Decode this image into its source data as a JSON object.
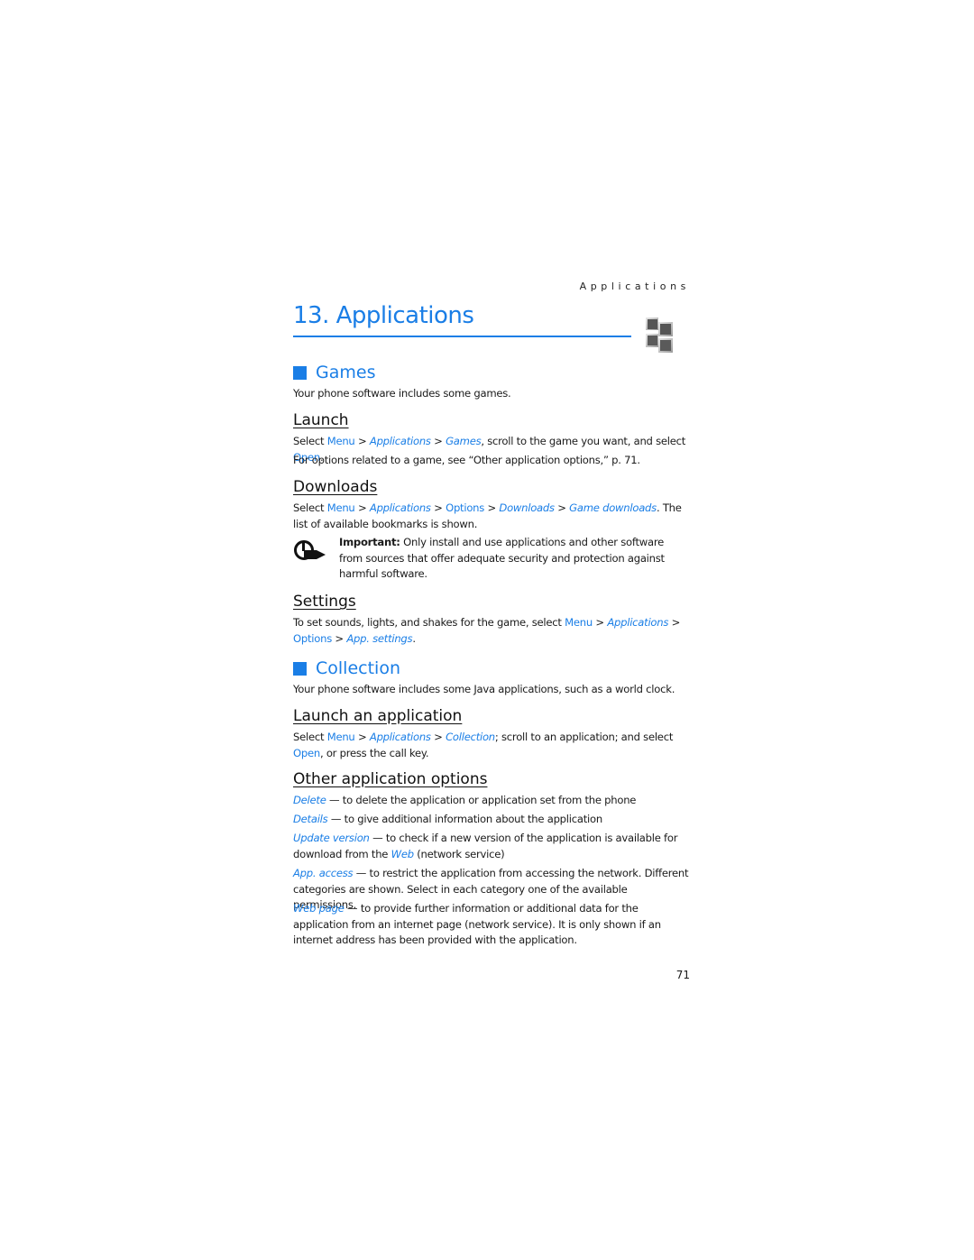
{
  "running_head": "Applications",
  "chapter": {
    "title": "13. Applications",
    "icon": "applications-cubes-icon"
  },
  "games": {
    "heading": "Games",
    "intro": "Your phone software includes some games.",
    "launch": {
      "heading": "Launch",
      "line1": {
        "pre": "Select ",
        "menu": "Menu",
        "sep1": " > ",
        "applications": "Applications",
        "sep2": " > ",
        "games": "Games",
        "mid": ", scroll to the game you want, and select ",
        "open": "Open",
        "post": "."
      },
      "line2": "For options related to a game, see “Other application options,” p. 71."
    },
    "downloads": {
      "heading": "Downloads",
      "line": {
        "pre": "Select ",
        "menu": "Menu",
        "sep1": " > ",
        "applications": "Applications",
        "sep2": " > ",
        "options": "Options",
        "sep3": " > ",
        "downloads": "Downloads",
        "sep4": " > ",
        "game_downloads": "Game downloads",
        "post": ". The list of available bookmarks is shown."
      },
      "note": {
        "label": "Important:",
        "text": " Only install and use applications and other software from sources that offer adequate security and protection against harmful software."
      }
    },
    "settings": {
      "heading": "Settings",
      "line": {
        "pre": "To set sounds, lights, and shakes for the game, select ",
        "menu": "Menu",
        "sep1": " > ",
        "applications": "Applications",
        "sep2": " > ",
        "options": "Options",
        "sep3": " > ",
        "app_settings": "App. settings",
        "post": "."
      }
    }
  },
  "collection": {
    "heading": "Collection",
    "intro": "Your phone software includes some Java applications, such as a world clock.",
    "launch_app": {
      "heading": "Launch an application",
      "line": {
        "pre": "Select ",
        "menu": "Menu",
        "sep1": " > ",
        "applications": "Applications",
        "sep2": " > ",
        "collection": "Collection",
        "mid": "; scroll to an application; and select ",
        "open": "Open",
        "post": ", or press the call key."
      }
    },
    "other_options": {
      "heading": "Other application options",
      "items": [
        {
          "term": "Delete",
          "desc": " — to delete the application or application set from the phone"
        },
        {
          "term": "Details",
          "desc": " — to give additional information about the application"
        },
        {
          "term": "Update version",
          "desc": " — to check if a new version of the application is available for download from the ",
          "link": "Web",
          "tail": " (network service)"
        },
        {
          "term": "App. access",
          "desc": " — to restrict the application from accessing the network. Different categories are shown. Select in each category one of the available permissions."
        },
        {
          "term": "Web page",
          "desc": " — to provide further information or additional data for the application from an internet page (network service). It is only shown if an internet address has been provided with the application."
        }
      ]
    }
  },
  "page_number": "71"
}
